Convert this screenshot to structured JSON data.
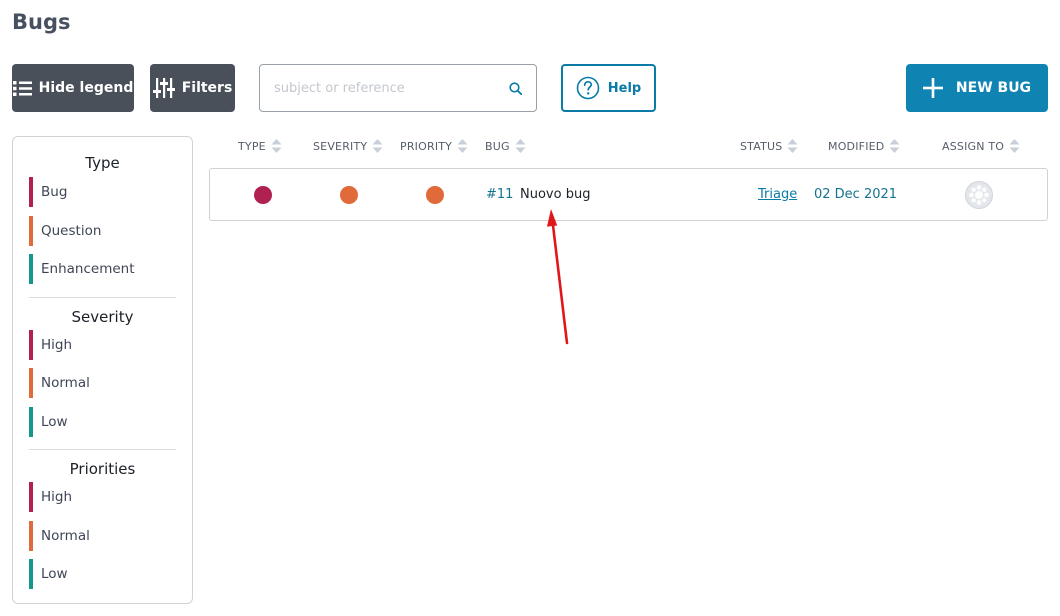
{
  "page": {
    "title": "Bugs"
  },
  "toolbar": {
    "hide_legend_label": "Hide legend",
    "filters_label": "Filters",
    "search_placeholder": "subject or reference",
    "help_label": "Help",
    "new_bug_label": "NEW BUG"
  },
  "legend": {
    "sections": [
      {
        "heading": "Type",
        "items": [
          {
            "label": "Bug",
            "color": "#b02050"
          },
          {
            "label": "Question",
            "color": "#e06a3a"
          },
          {
            "label": "Enhancement",
            "color": "#15978f"
          }
        ]
      },
      {
        "heading": "Severity",
        "items": [
          {
            "label": "High",
            "color": "#b02050"
          },
          {
            "label": "Normal",
            "color": "#e06a3a"
          },
          {
            "label": "Low",
            "color": "#15978f"
          }
        ]
      },
      {
        "heading": "Priorities",
        "items": [
          {
            "label": "High",
            "color": "#b02050"
          },
          {
            "label": "Normal",
            "color": "#e06a3a"
          },
          {
            "label": "Low",
            "color": "#15978f"
          }
        ]
      }
    ]
  },
  "table": {
    "columns": [
      "TYPE",
      "SEVERITY",
      "PRIORITY",
      "BUG",
      "STATUS",
      "MODIFIED",
      "ASSIGN TO"
    ],
    "rows": [
      {
        "type_color": "#b02050",
        "severity_color": "#e06a3a",
        "priority_color": "#e06a3a",
        "ref": "#11",
        "subject": "Nuovo bug",
        "status": "Triage",
        "modified": "02 Dec 2021"
      }
    ]
  },
  "colors": {
    "primary": "#0f84b3",
    "dark_button": "#4a5059",
    "annotation_arrow": "#e0161b"
  }
}
